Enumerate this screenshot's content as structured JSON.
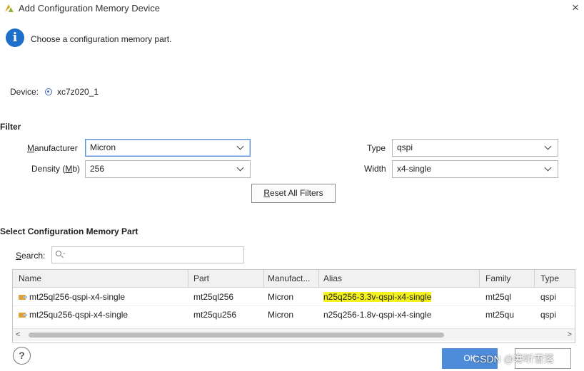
{
  "window": {
    "title": "Add Configuration Memory Device",
    "close_icon": "×"
  },
  "info": {
    "icon": "i",
    "message": "Choose a configuration memory part."
  },
  "device": {
    "label": "Device:",
    "value": "xc7z020_1"
  },
  "filter": {
    "title": "Filter",
    "manufacturer": {
      "label_mnemonic": "M",
      "label_rest": "anufacturer",
      "value": "Micron"
    },
    "density": {
      "label_pre": "Density (",
      "label_mnemonic": "M",
      "label_post": "b)",
      "value": "256"
    },
    "type": {
      "label": "Type",
      "value": "qspi"
    },
    "width": {
      "label": "Width",
      "value": "x4-single"
    },
    "reset": {
      "mnemonic": "R",
      "rest": "eset All Filters"
    }
  },
  "select": {
    "title": "Select Configuration Memory Part",
    "search": {
      "label_mnemonic": "S",
      "label_rest": "earch:",
      "caret": "-",
      "value": ""
    },
    "columns": [
      "Name",
      "Part",
      "Manufact...",
      "Alias",
      "Family",
      "Type"
    ],
    "rows": [
      {
        "name": "mt25ql256-qspi-x4-single",
        "part": "mt25ql256",
        "manufacturer": "Micron",
        "alias": "n25q256-3.3v-qspi-x4-single",
        "family": "mt25ql",
        "type": "qspi",
        "alias_highlighted": true
      },
      {
        "name": "mt25qu256-qspi-x4-single",
        "part": "mt25qu256",
        "manufacturer": "Micron",
        "alias": "n25q256-1.8v-qspi-x4-single",
        "family": "mt25qu",
        "type": "qspi",
        "alias_highlighted": false
      }
    ]
  },
  "scroll": {
    "left_arrow": "<",
    "right_arrow": ">"
  },
  "footer": {
    "help": "?",
    "ok_label": "OK",
    "watermark": "CSDN @寒听雪落"
  },
  "colors": {
    "accent": "#4e8bd9",
    "info": "#1e6fc9",
    "highlight": "#f4f21e"
  }
}
